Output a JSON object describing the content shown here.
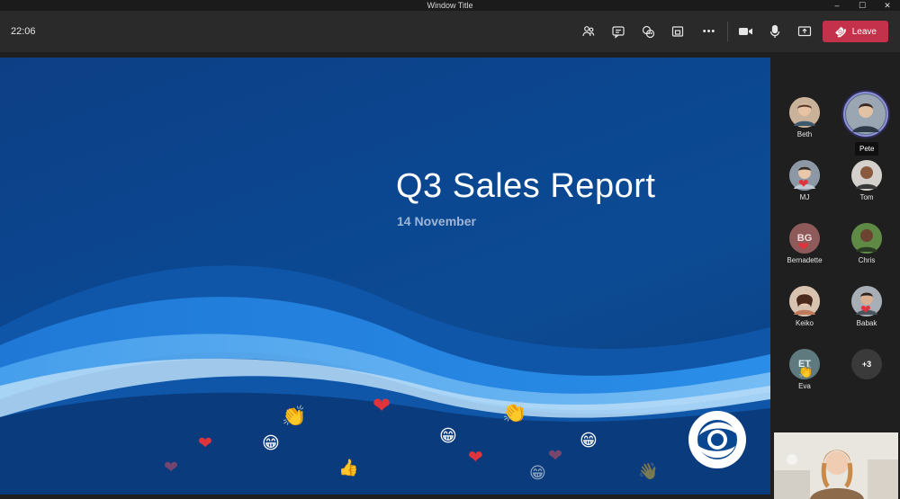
{
  "window": {
    "title": "Window Title",
    "minimize": "–",
    "maximize": "☐",
    "close": "✕"
  },
  "toolbar": {
    "clock": "22:06",
    "leave_label": "Leave",
    "icons": {
      "participants": "👥",
      "chat": "💬",
      "reactions": "☺",
      "share_tray": "⧉",
      "more": "•••",
      "camera": "📹",
      "mic": "🎙",
      "share": "⬆",
      "phone": "☎"
    }
  },
  "slide": {
    "title": "Q3 Sales Report",
    "date": "14 November",
    "reactions": {
      "heart": "❤",
      "clap": "👏",
      "laugh": "😁",
      "like": "👍",
      "wave": "👋"
    }
  },
  "participants": [
    {
      "name": "Beth",
      "initials": "",
      "color": "#8a6a58"
    },
    {
      "name": "Pete",
      "initials": "",
      "color": "#5a6f86",
      "tooltip": "Pete"
    },
    {
      "name": "MJ",
      "initials": "",
      "color": "#7a8088"
    },
    {
      "name": "Tom",
      "initials": "",
      "color": "#6b564a"
    },
    {
      "name": "Bernadette",
      "initials": "BG",
      "color": "#8e5a5a"
    },
    {
      "name": "Chris",
      "initials": "",
      "color": "#4f6a3a"
    },
    {
      "name": "Keiko",
      "initials": "",
      "color": "#9a6a55"
    },
    {
      "name": "Babak",
      "initials": "",
      "color": "#6a6f74"
    },
    {
      "name": "Eva",
      "initials": "ET",
      "color": "#5f7a7f"
    }
  ],
  "overflow_label": "+3",
  "colors": {
    "leave": "#c4314b",
    "slide_bg": "#0b4791",
    "accent_ring": "#8f90d9"
  }
}
